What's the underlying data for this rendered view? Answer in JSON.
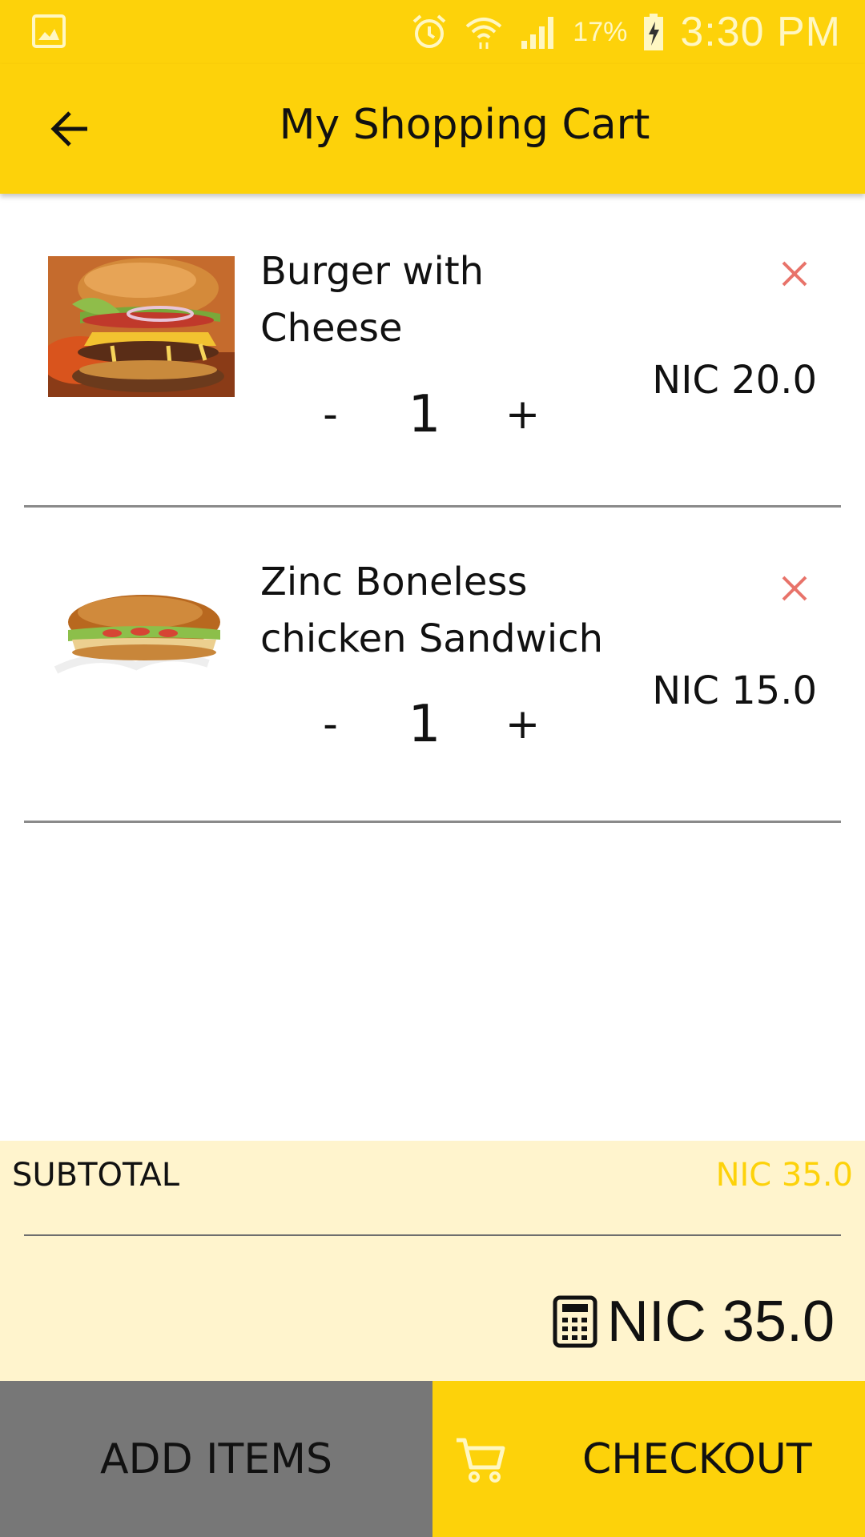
{
  "status_bar": {
    "battery_percent": "17%",
    "time": "3:30 PM"
  },
  "app_bar": {
    "title": "My Shopping Cart"
  },
  "cart": {
    "items": [
      {
        "name": "Burger with Cheese",
        "quantity": "1",
        "price": "NIC 20.0",
        "minus_label": "-",
        "plus_label": "+",
        "remove_label": "×"
      },
      {
        "name": "Zinc Boneless chicken Sandwich",
        "quantity": "1",
        "price": "NIC 15.0",
        "minus_label": "-",
        "plus_label": "+",
        "remove_label": "×"
      }
    ]
  },
  "summary": {
    "subtotal_label": "SUBTOTAL",
    "subtotal_value": "NIC 35.0",
    "total_value": "NIC 35.0"
  },
  "buttons": {
    "add_items": "ADD ITEMS",
    "checkout": "CHECKOUT"
  },
  "colors": {
    "accent": "#fdd20a",
    "summary_bg": "#fff4cd",
    "remove": "#e8736a",
    "add_button_bg": "#777777"
  }
}
